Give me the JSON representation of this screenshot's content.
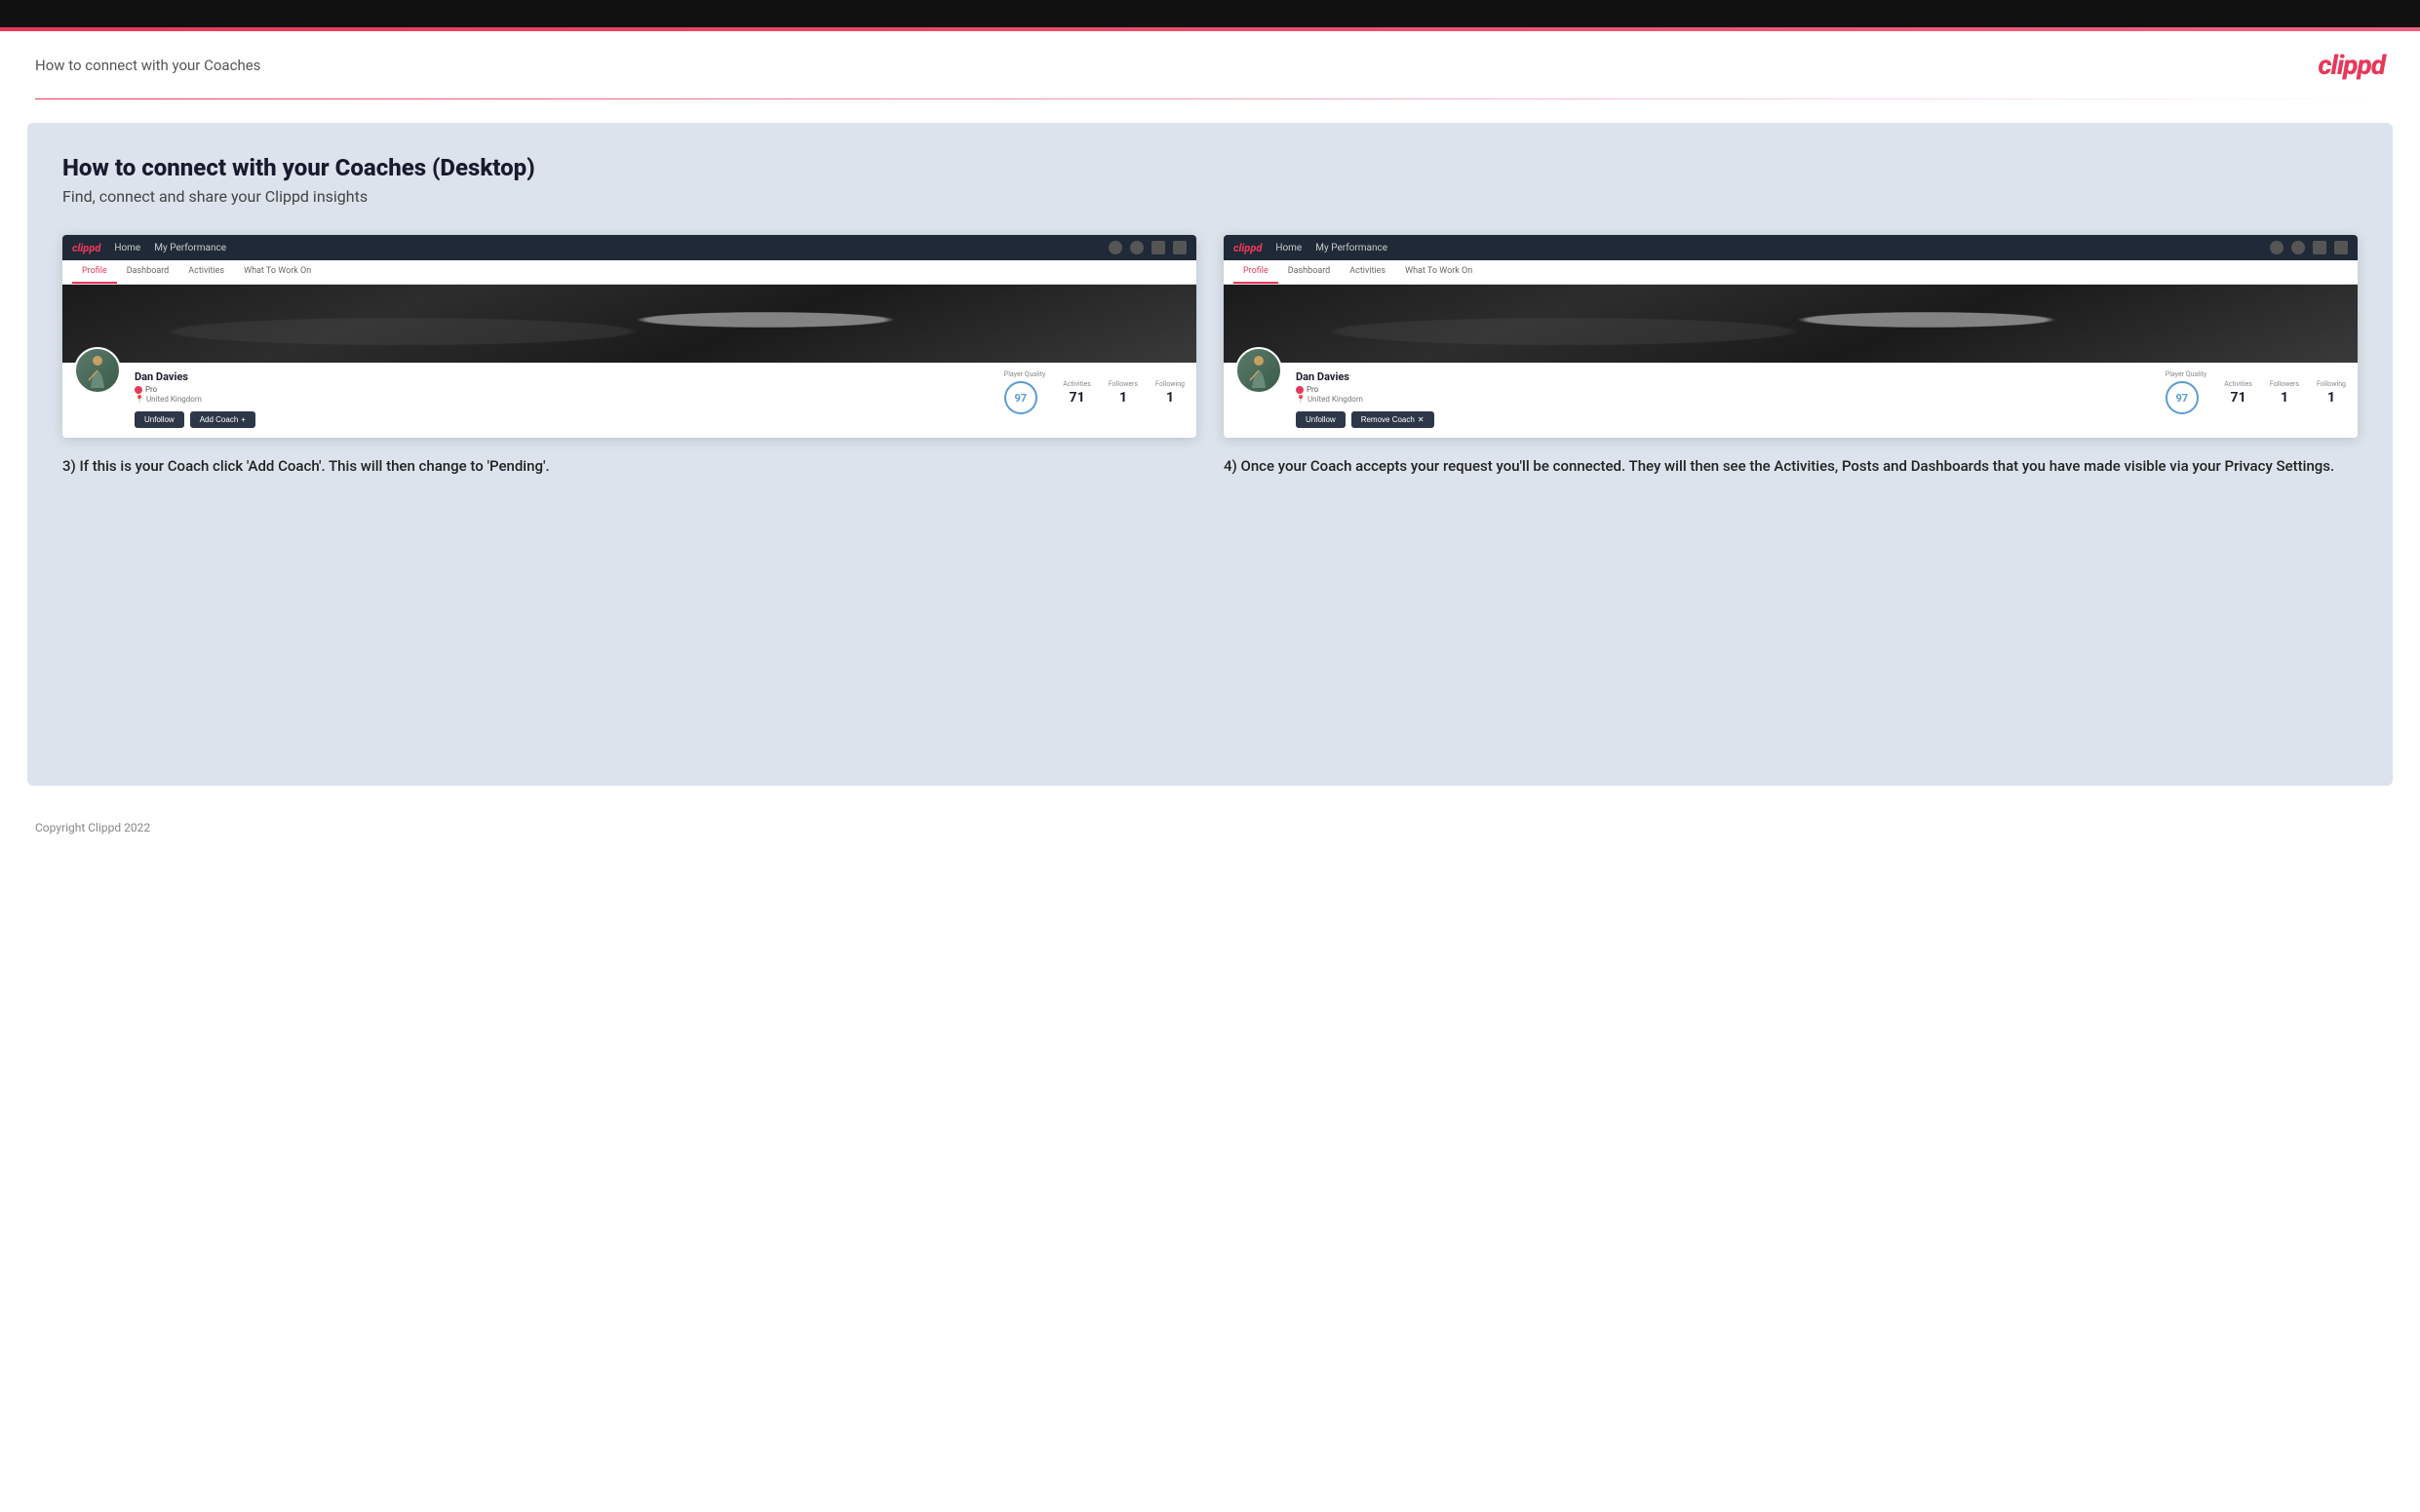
{
  "header": {
    "title": "How to connect with your Coaches",
    "logo": "clippd"
  },
  "main": {
    "title": "How to connect with your Coaches (Desktop)",
    "subtitle": "Find, connect and share your Clippd insights",
    "screen1": {
      "nav": {
        "logo": "clippd",
        "links": [
          "Home",
          "My Performance"
        ]
      },
      "tabs": [
        "Profile",
        "Dashboard",
        "Activities",
        "What To Work On"
      ],
      "active_tab": "Profile",
      "player": {
        "name": "Dan Davies",
        "badge": "Pro",
        "location": "United Kingdom",
        "player_quality_label": "Player Quality",
        "player_quality_value": "97",
        "activities_label": "Activities",
        "activities_value": "71",
        "followers_label": "Followers",
        "followers_value": "1",
        "following_label": "Following",
        "following_value": "1"
      },
      "buttons": {
        "unfollow": "Unfollow",
        "add_coach": "Add Coach"
      }
    },
    "screen2": {
      "nav": {
        "logo": "clippd",
        "links": [
          "Home",
          "My Performance"
        ]
      },
      "tabs": [
        "Profile",
        "Dashboard",
        "Activities",
        "What To Work On"
      ],
      "active_tab": "Profile",
      "player": {
        "name": "Dan Davies",
        "badge": "Pro",
        "location": "United Kingdom",
        "player_quality_label": "Player Quality",
        "player_quality_value": "97",
        "activities_label": "Activities",
        "activities_value": "71",
        "followers_label": "Followers",
        "followers_value": "1",
        "following_label": "Following",
        "following_value": "1"
      },
      "buttons": {
        "unfollow": "Unfollow",
        "remove_coach": "Remove Coach"
      }
    },
    "step3_text": "3) If this is your Coach click 'Add Coach'. This will then change to 'Pending'.",
    "step4_text": "4) Once your Coach accepts your request you'll be connected. They will then see the Activities, Posts and Dashboards that you have made visible via your Privacy Settings."
  },
  "footer": {
    "copyright": "Copyright Clippd 2022"
  }
}
